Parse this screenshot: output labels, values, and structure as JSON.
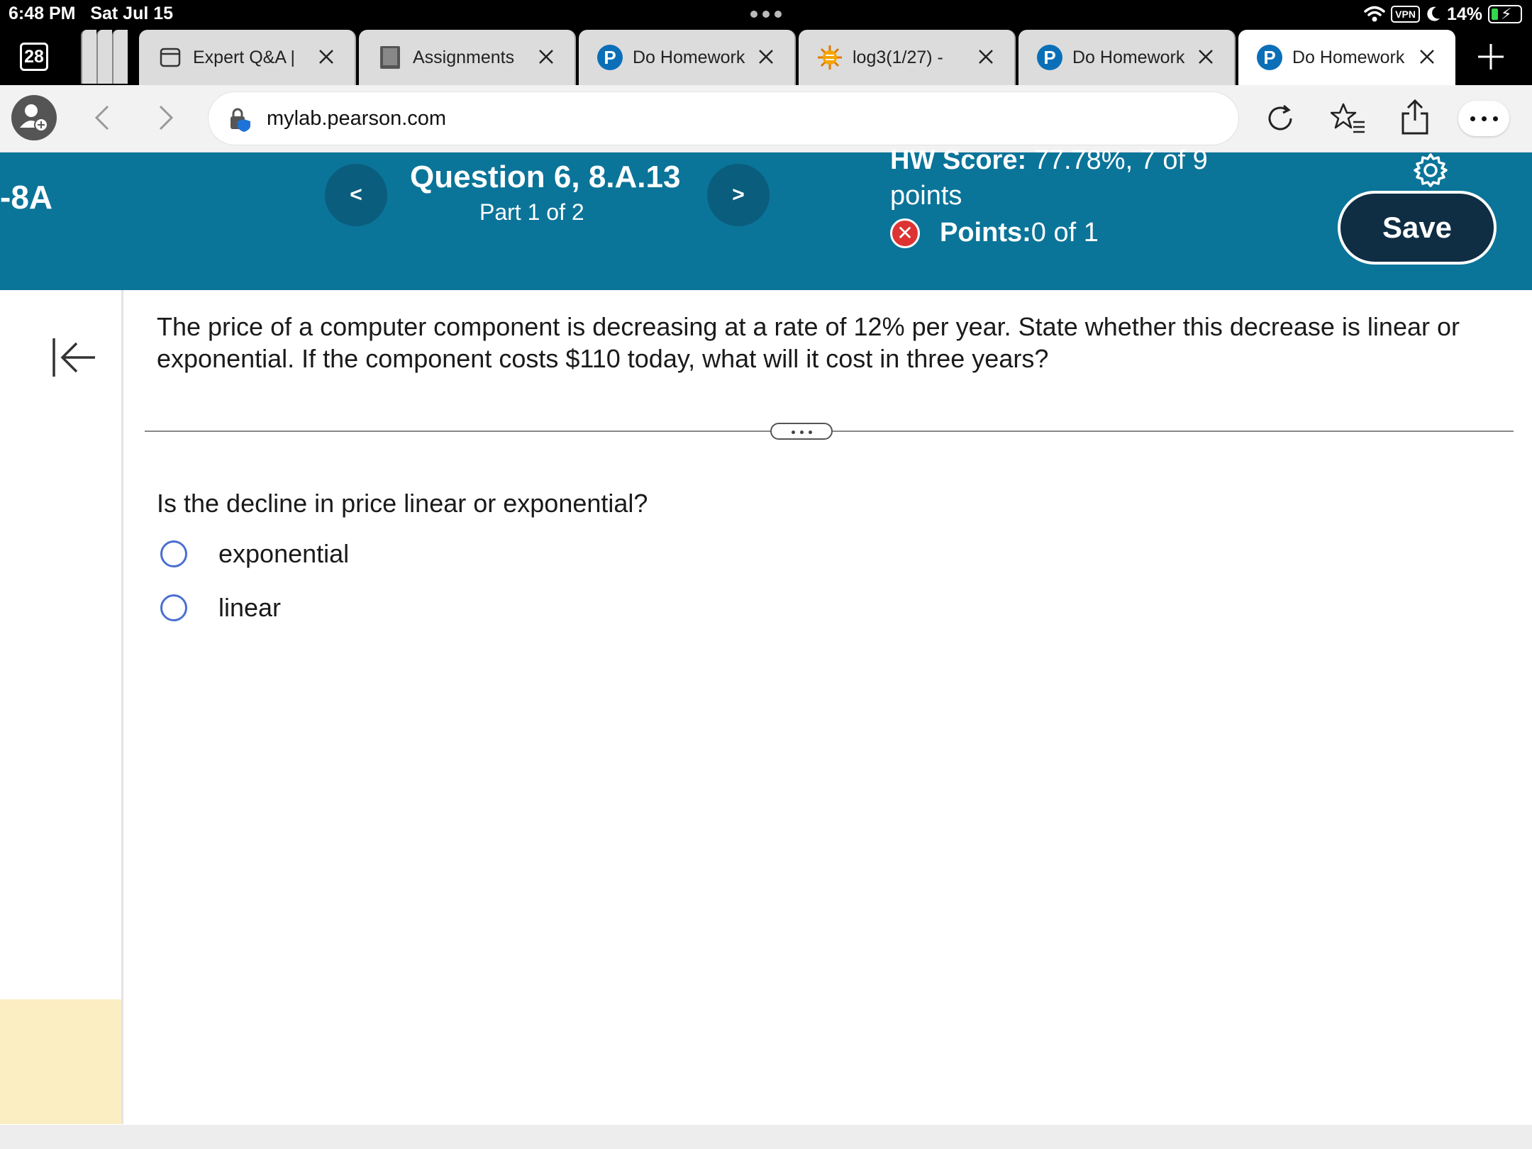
{
  "status_bar": {
    "time": "6:48 PM",
    "date": "Sat Jul 15",
    "vpn": "VPN",
    "battery": "14%"
  },
  "browser": {
    "tab_count": "28",
    "tabs": [
      {
        "label": "Expert Q&A |",
        "icon": "document-icon"
      },
      {
        "label": "Assignments",
        "icon": "book-icon"
      },
      {
        "label": "Do Homework",
        "icon": "pearson-logo-icon"
      },
      {
        "label": "log3(1/27) - ",
        "icon": "sun-icon"
      },
      {
        "label": "Do Homework",
        "icon": "pearson-logo-icon"
      },
      {
        "label": "Do Homework",
        "icon": "pearson-logo-icon"
      }
    ],
    "pearson_letter": "P",
    "url": "mylab.pearson.com"
  },
  "header": {
    "section": "8A",
    "question_title": "Question 6, 8.A.13",
    "part": "Part 1 of 2",
    "hw_score_label": "HW Score:",
    "hw_score_value": " 77.78%, 7 of 9 points",
    "points_label": "Points:",
    "points_value": " 0 of 1",
    "save_label": "Save",
    "prev_symbol": "<",
    "next_symbol": ">",
    "incorrect_symbol": "✕"
  },
  "content": {
    "question": "The price of a computer component is decreasing at a rate of 12% per year. State whether this decrease is linear or exponential. If the component costs $110 today, what will it cost in three years?",
    "sub_question": "Is the decline in price linear or exponential?",
    "options": [
      "exponential",
      "linear"
    ]
  },
  "colors": {
    "header_bg": "#0b7499",
    "save_bg": "#0f2d43",
    "radio_ring": "#4a6fd1",
    "incorrect": "#dd3333"
  }
}
